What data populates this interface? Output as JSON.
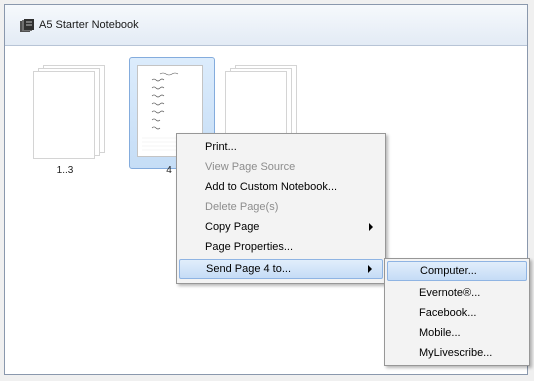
{
  "window": {
    "title": "A5 Starter Notebook",
    "title_icon": "notebook-icon"
  },
  "thumbnails": [
    {
      "label": "1..3",
      "selected": false
    },
    {
      "label": "4",
      "selected": true
    },
    {
      "label": "",
      "selected": false
    }
  ],
  "context_menu": {
    "items": [
      {
        "label": "Print...",
        "enabled": true
      },
      {
        "label": "View Page Source",
        "enabled": false
      },
      {
        "label": "Add to Custom Notebook...",
        "enabled": true
      },
      {
        "label": "Delete Page(s)",
        "enabled": false
      },
      {
        "label": "Copy Page",
        "enabled": true,
        "submenu": true
      },
      {
        "label": "Page Properties...",
        "enabled": true
      },
      {
        "label": "Send Page 4 to...",
        "enabled": true,
        "submenu": true,
        "highlighted": true
      }
    ]
  },
  "send_submenu": {
    "items": [
      {
        "label": "Computer...",
        "highlighted": true
      },
      {
        "label": "Evernote®..."
      },
      {
        "label": "Facebook..."
      },
      {
        "label": "Mobile..."
      },
      {
        "label": "MyLivescribe..."
      }
    ]
  },
  "colors": {
    "highlight": "#c5dcf6",
    "selection_border": "#84acdd"
  }
}
